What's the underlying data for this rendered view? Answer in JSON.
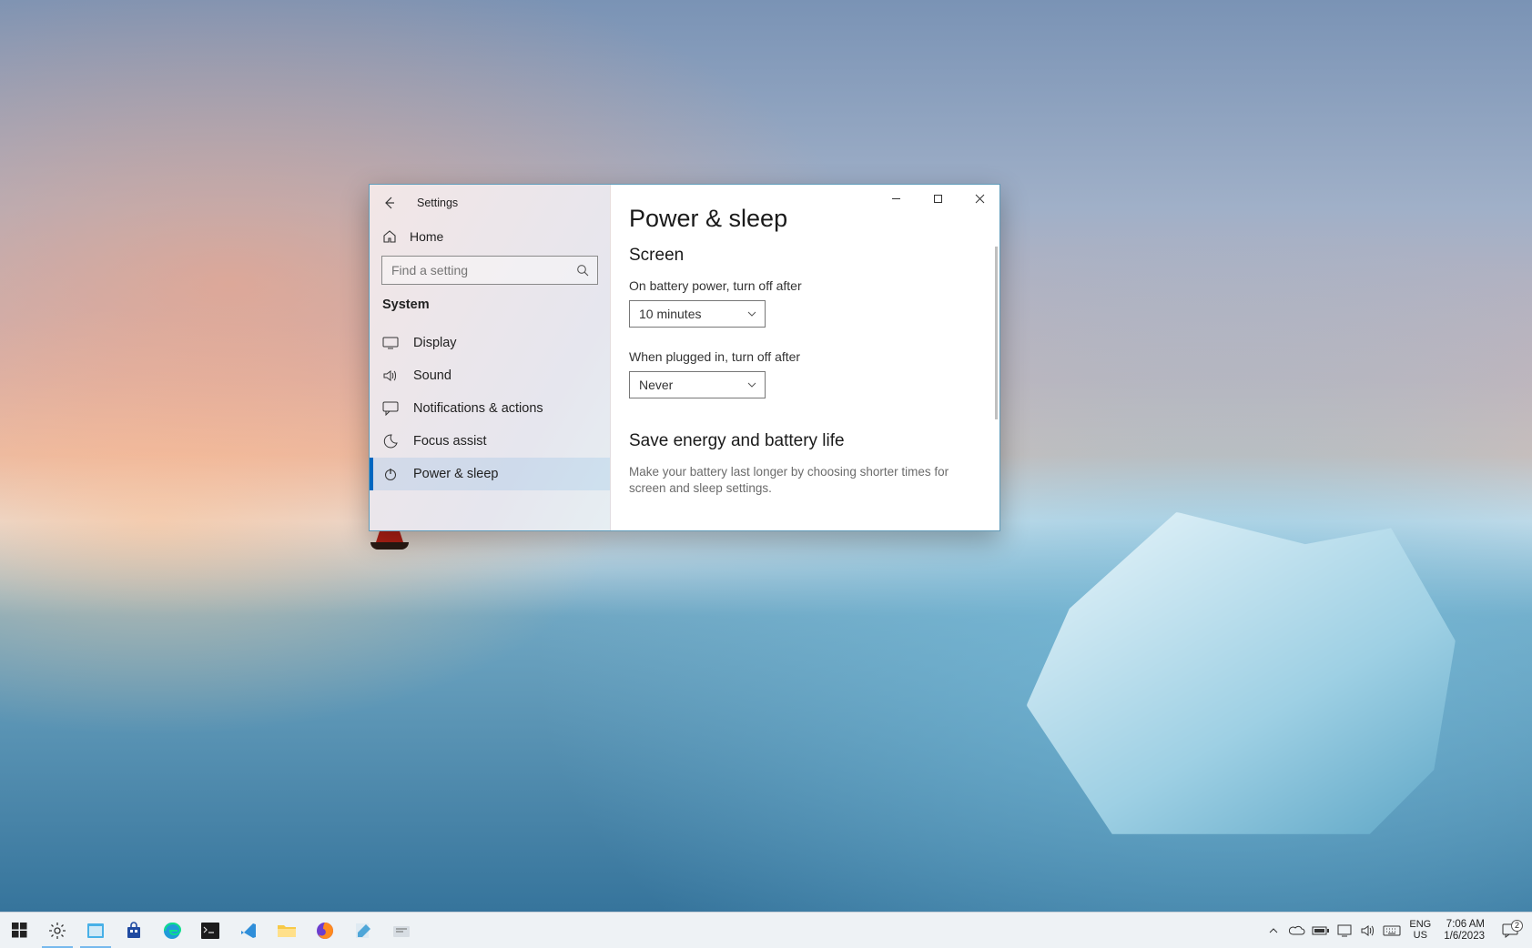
{
  "window": {
    "title": "Settings",
    "home_label": "Home",
    "search_placeholder": "Find a setting",
    "section_label": "System",
    "nav": [
      {
        "label": "Display"
      },
      {
        "label": "Sound"
      },
      {
        "label": "Notifications & actions"
      },
      {
        "label": "Focus assist"
      },
      {
        "label": "Power & sleep"
      }
    ]
  },
  "page": {
    "heading": "Power & sleep",
    "screen_heading": "Screen",
    "battery_label": "On battery power, turn off after",
    "battery_value": "10 minutes",
    "plugged_label": "When plugged in, turn off after",
    "plugged_value": "Never",
    "energy_heading": "Save energy and battery life",
    "energy_help": "Make your battery last longer by choosing shorter times for screen and sleep settings."
  },
  "taskbar": {
    "lang_top": "ENG",
    "lang_bottom": "US",
    "time": "7:06 AM",
    "date": "1/6/2023",
    "notification_count": "2"
  }
}
